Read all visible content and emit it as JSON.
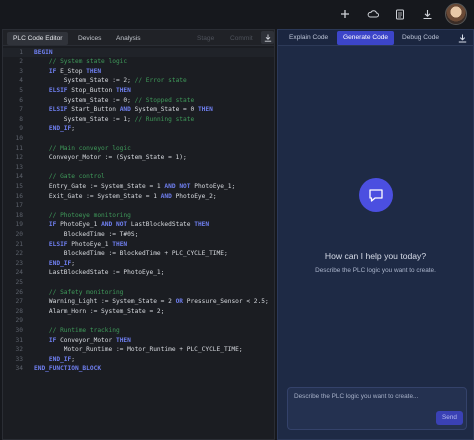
{
  "topbar": {
    "icons": [
      "plus-icon",
      "cloud-icon",
      "document-icon",
      "download-icon"
    ]
  },
  "editor": {
    "tabs": [
      "PLC Code Editor",
      "Devices",
      "Analysis"
    ],
    "actions": [
      "Stage",
      "Commit"
    ],
    "code_lines": [
      "BEGIN",
      "    // System state logic",
      "    IF E_Stop THEN",
      "        System_State := 2; // Error state",
      "    ELSIF Stop_Button THEN",
      "        System_State := 0; // Stopped state",
      "    ELSIF Start_Button AND System_State = 0 THEN",
      "        System_State := 1; // Running state",
      "    END_IF;",
      "",
      "    // Main conveyor logic",
      "    Conveyor_Motor := (System_State = 1);",
      "",
      "    // Gate control",
      "    Entry_Gate := System_State = 1 AND NOT PhotoEye_1;",
      "    Exit_Gate := System_State = 1 AND PhotoEye_2;",
      "",
      "    // Photoeye monitoring",
      "    IF PhotoEye_1 AND NOT LastBlockedState THEN",
      "        BlockedTime := T#0S;",
      "    ELSIF PhotoEye_1 THEN",
      "        BlockedTime := BlockedTime + PLC_CYCLE_TIME;",
      "    END_IF;",
      "    LastBlockedState := PhotoEye_1;",
      "",
      "    // Safety monitoring",
      "    Warning_Light := System_State = 2 OR Pressure_Sensor < 2.5;",
      "    Alarm_Horn := System_State = 2;",
      "",
      "    // Runtime tracking",
      "    IF Conveyor_Motor THEN",
      "        Motor_Runtime := Motor_Runtime + PLC_CYCLE_TIME;",
      "    END_IF;",
      "END_FUNCTION_BLOCK"
    ]
  },
  "assistant": {
    "tabs": [
      "Explain Code",
      "Generate Code",
      "Debug Code"
    ],
    "active_tab": "Generate Code",
    "greeting": "How can I help you today?",
    "subtitle": "Describe the PLC logic you want to create.",
    "input_placeholder": "Describe the PLC logic you want to create...",
    "send_label": "Send"
  },
  "colors": {
    "accent": "#3c45c9",
    "keyword": "#6f7ff0",
    "comment": "#3f9a5a",
    "editor_bg": "#1b1d22",
    "assistant_bg": "#1e2a45"
  }
}
